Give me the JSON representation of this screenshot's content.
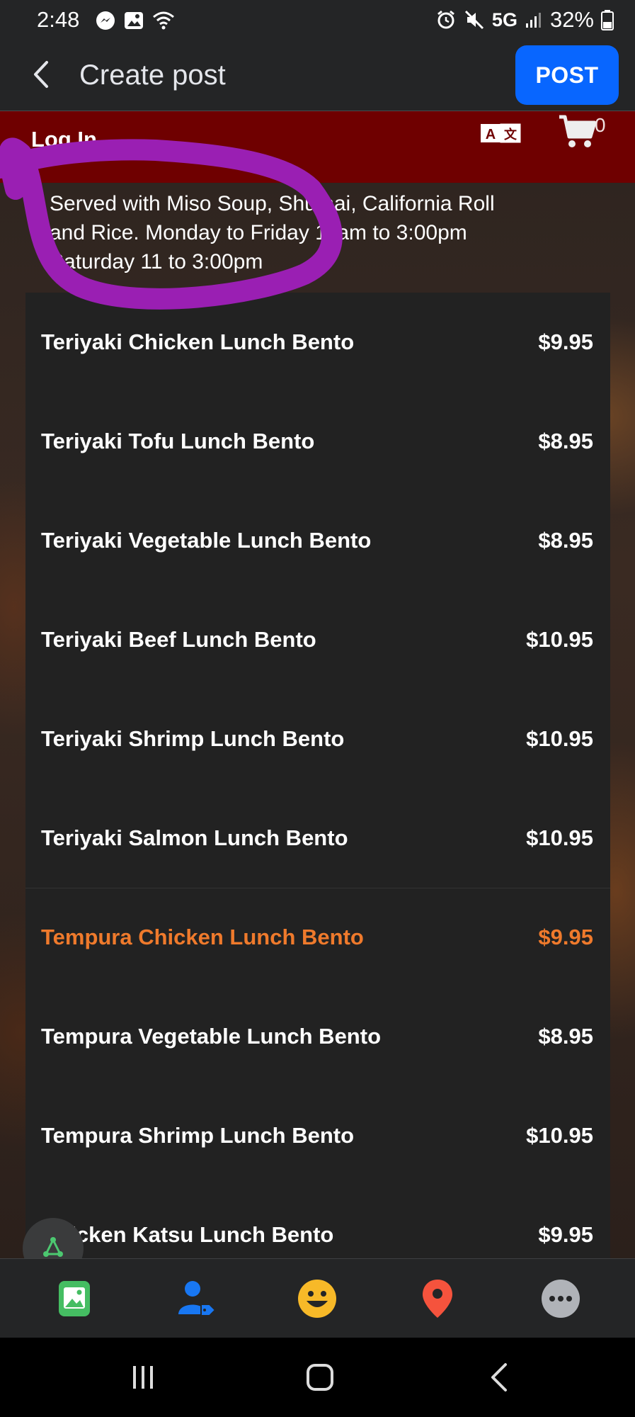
{
  "status_bar": {
    "time": "2:48",
    "network": "5G",
    "battery": "32%",
    "icons": [
      "messenger-icon",
      "gallery-icon",
      "wifi-icon",
      "alarm-icon",
      "mute-icon",
      "signal-icon",
      "battery-icon"
    ]
  },
  "header": {
    "title": "Create post",
    "post_label": "POST",
    "accent_color": "#0866ff"
  },
  "site": {
    "login_label": "Log In",
    "cart_count": "0",
    "header_color": "#6f0000",
    "intro_lines": [
      "Served with Miso Soup, Shumai, California Roll",
      "and Rice. Monday to Friday 11am to 3:00pm",
      "Saturday 11 to 3:00pm"
    ],
    "menu_items": [
      {
        "name": "Teriyaki Chicken Lunch Bento",
        "price": "$9.95"
      },
      {
        "name": "Teriyaki Tofu Lunch Bento",
        "price": "$8.95"
      },
      {
        "name": "Teriyaki Vegetable Lunch Bento",
        "price": "$8.95"
      },
      {
        "name": "Teriyaki Beef Lunch Bento",
        "price": "$10.95"
      },
      {
        "name": "Teriyaki Shrimp Lunch Bento",
        "price": "$10.95"
      },
      {
        "name": "Teriyaki Salmon Lunch Bento",
        "price": "$10.95"
      },
      {
        "name": "Tempura Chicken Lunch Bento",
        "price": "$9.95"
      },
      {
        "name": "Tempura Vegetable Lunch Bento",
        "price": "$8.95"
      },
      {
        "name": "Tempura Shrimp Lunch Bento",
        "price": "$10.95"
      },
      {
        "name": "Chicken Katsu Lunch Bento",
        "price": "$9.95"
      }
    ],
    "highlight_color": "#ef7a2c",
    "annotation_color": "#9a1fb3"
  },
  "composer": {
    "buttons": [
      "photo-icon",
      "tag-people-icon",
      "feeling-icon",
      "location-icon",
      "more-icon"
    ]
  },
  "nav": {
    "buttons": [
      "recent-apps-icon",
      "home-icon",
      "back-icon"
    ]
  }
}
